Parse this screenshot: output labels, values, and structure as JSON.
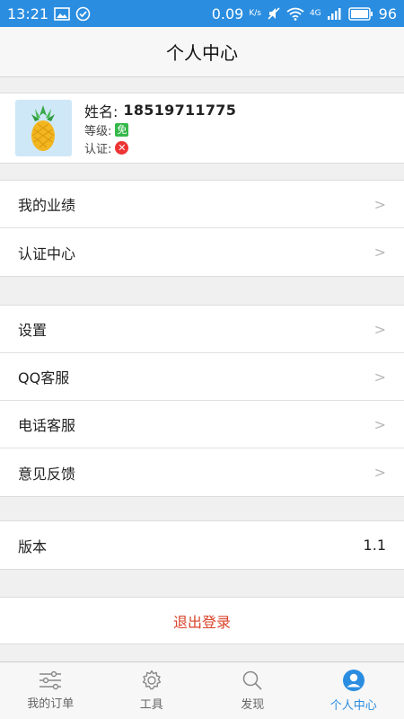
{
  "status_bar": {
    "time": "13:21",
    "speed": "0.09",
    "speed_unit": "K/s",
    "network": "4G",
    "battery": "96"
  },
  "navbar": {
    "title": "个人中心"
  },
  "profile": {
    "name_label": "姓名:",
    "name_value": "18519711775",
    "level_label": "等级:",
    "level_badge": "免",
    "cert_label": "认证:",
    "cert_status_icon": "x-icon"
  },
  "menu_group_1": [
    {
      "label": "我的业绩"
    },
    {
      "label": "认证中心"
    }
  ],
  "menu_group_2": [
    {
      "label": "设置"
    },
    {
      "label": "QQ客服"
    },
    {
      "label": "电话客服"
    },
    {
      "label": "意见反馈"
    }
  ],
  "version": {
    "label": "版本",
    "value": "1.1"
  },
  "logout_label": "退出登录",
  "tabs": [
    {
      "label": "我的订单",
      "icon": "sliders-icon"
    },
    {
      "label": "工具",
      "icon": "gear-icon"
    },
    {
      "label": "发现",
      "icon": "search-icon"
    },
    {
      "label": "个人中心",
      "icon": "person-icon"
    }
  ],
  "colors": {
    "accent": "#2a8de0",
    "logout": "#d9432a",
    "badge_green": "#35b84a",
    "badge_red": "#e33333"
  }
}
